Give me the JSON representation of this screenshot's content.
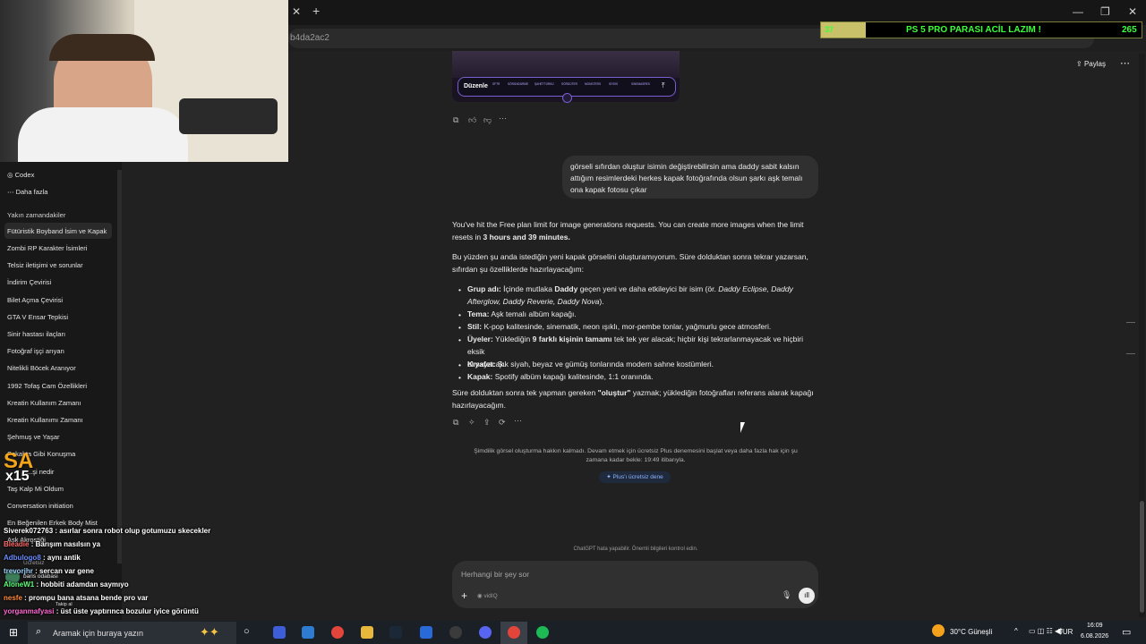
{
  "browser": {
    "url_fragment": "b4da2ac2",
    "close_tab_glyph": "✕",
    "new_tab_glyph": "+"
  },
  "donation": {
    "count_left": "37",
    "text": "PS 5 PRO PARASI ACİL LAZIM !",
    "count_right": "265"
  },
  "header": {
    "share_label": "Paylaş"
  },
  "sidebar": {
    "top_items": [
      {
        "label": "Codex"
      },
      {
        "label": "Daha fazla"
      }
    ],
    "section_title": "Yakın zamandakiler",
    "items": [
      {
        "label": "Fütüristik Boyband İsim ve Kapak"
      },
      {
        "label": "Zombi RP Karakter İsimleri"
      },
      {
        "label": "Telsiz iletişimi ve sorunlar"
      },
      {
        "label": "İndirim Çevirisi"
      },
      {
        "label": "Bilet Açma Çevirisi"
      },
      {
        "label": "GTA V Ensar Tepkisi"
      },
      {
        "label": "Sinir hastası ilaçları"
      },
      {
        "label": "Fotoğraf işçi arıyan"
      },
      {
        "label": "Nitelikli Böcek Aranıyor"
      },
      {
        "label": "1992 Tofaş Cam Özellikleri"
      },
      {
        "label": "Kreatin Kullanım Zamanı"
      },
      {
        "label": "Kreatin Kullanımı Zamanı"
      },
      {
        "label": "Şehmuş ve Yaşar"
      },
      {
        "label": "Sokakta Gibi Konuşma"
      },
      {
        "label": "...şi nedir"
      },
      {
        "label": "Taş Kalp Mi Oldum"
      },
      {
        "label": "Conversation initiation"
      },
      {
        "label": "En Beğenilen Erkek Body Mist"
      },
      {
        "label": "Aşk Akrostiği"
      }
    ],
    "user": {
      "name": "baris odabasi",
      "plan": "Ücretsiz"
    }
  },
  "image_card": {
    "edit_label": "Düzenle",
    "tags": [
      "SFTR",
      "SÖRÜNDÜRME",
      "ŞAHETTÜRKÜ",
      "SÖRDÜTER",
      "MONSTERS",
      "SİYEKİ",
      "SINEMASRES"
    ]
  },
  "user_message": {
    "text": "görseli sıfırdan oluştur isimin değiştirebilirsin ama daddy sabit kalsın attığım resimlerdeki herkes kapak fotoğrafında olsun şarkı aşk temalı ona kapak fotosu çıkar"
  },
  "assistant": {
    "limit_line1": "You've hit the Free plan limit for image generations requests. You can create more images when the limit",
    "limit_line2_pre": "resets in",
    "limit_line2_bold": "3 hours and 39 minutes.",
    "para2_line1": "Bu yüzden şu anda istediğin yeni kapak görselini oluşturamıyorum. Süre dolduktan sonra tekrar yazarsan,",
    "para2_line2": "sıfırdan şu özelliklerde hazırlayacağım:",
    "bullets": [
      {
        "bold": "Grup adı:",
        "text": "İçinde mutlaka",
        "bold2": "Daddy",
        "text2": "geçen yeni ve daha etkileyici bir isim (ör.",
        "ital": "Daddy Eclipse, Daddy",
        "line2_ital": "Afterglow, Daddy Reverie, Daddy Nova",
        "line2_end": ")."
      },
      {
        "bold": "Tema:",
        "text": "Aşk temalı albüm kapağı."
      },
      {
        "bold": "Stil:",
        "text": "K-pop kalitesinde, sinematik, neon ışıklı, mor-pembe tonlar, yağmurlu gece atmosferi."
      },
      {
        "bold": "Üyeler:",
        "text": "Yüklediğin",
        "bold2": "9 farklı kişinin tamamı",
        "text2": "tek tek yer alacak; hiçbir kişi tekrarlanmayacak ve hiçbiri eksik",
        "line2": "olmayacak."
      },
      {
        "bold": "Kıyafet:",
        "text": "Şık siyah, beyaz ve gümüş tonlarında modern sahne kostümleri."
      },
      {
        "bold": "Kapak:",
        "text": "Spotify albüm kapağı kalitesinde, 1:1 oranında."
      }
    ],
    "final_pre": "Süre dolduktan sonra tek yapman gereken",
    "final_bold": "\"oluştur\"",
    "final_post": "yazmak; yüklediğin fotoğrafları referans alarak kapağı",
    "final_line2": "hazırlayacağım."
  },
  "limit_notice": {
    "line1": "Şimdilik görsel oluşturma hakkın kalmadı. Devam etmek için ücretsiz Plus denemesini başlat veya daha fazla hak için şu",
    "line2": "zamana kadar bekle: 19:49 itibarıyla.",
    "button": "Plus'ı ücretsiz dene"
  },
  "disclaimer": "ChatGPT hata yapabilir. Önemli bilgileri kontrol edin.",
  "composer": {
    "placeholder": "Herhangi bir şey sor",
    "chip": "vidIQ"
  },
  "stream_overlay": {
    "badge_top": "SA",
    "badge_bottom": "x15",
    "chat": [
      {
        "user": "Siverek072763",
        "text": ": asırlar sonra robot olup gotumuzu skecekler",
        "color": "#ffffff"
      },
      {
        "user": "Bleadie",
        "text": ": Barışım nasılsın ya",
        "color": "#ff6a6a"
      },
      {
        "user": "Adbulogo8",
        "text": ": aynı antik",
        "color": "#6a8cff"
      },
      {
        "user": "trevorjhr",
        "text": ": sercan var gene",
        "color": "#9fd3ff"
      },
      {
        "user": "AloneW1",
        "text": ": hobbiti adamdan saymıyo",
        "color": "#5dff7a"
      },
      {
        "user": "nesfe",
        "text": ": prompu bana atsana bende pro var",
        "color": "#ff8a3d"
      },
      {
        "user": "yorganmafyasi",
        "text": ": üst üste yaptırınca bozulur iyice görüntü",
        "color": "#ff6ad5"
      }
    ],
    "follow_label": "Takip al"
  },
  "taskbar": {
    "search_placeholder": "Aramak için buraya yazın",
    "weather": "30°C  Güneşli",
    "lang": "TUR",
    "time": "16:09",
    "date": "6.08.2026"
  }
}
